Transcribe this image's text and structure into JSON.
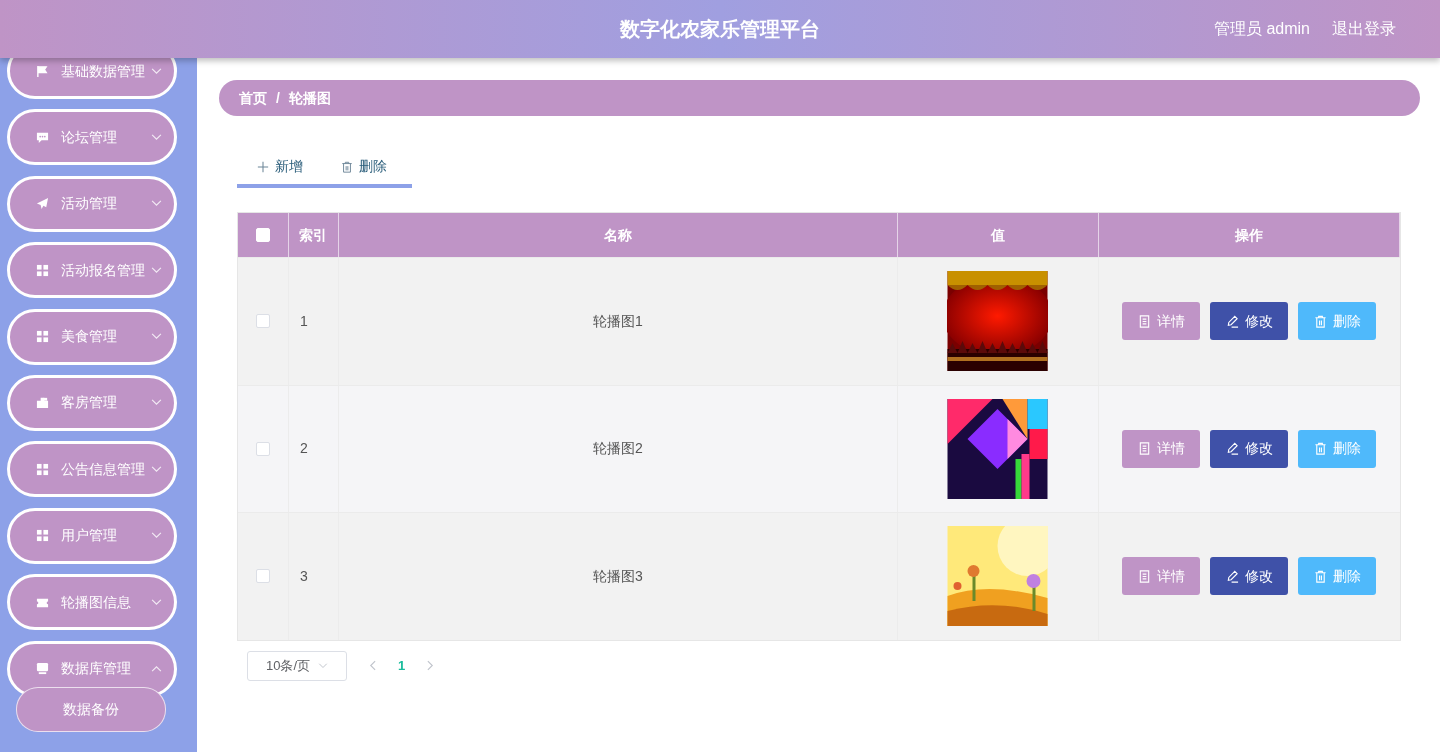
{
  "header": {
    "title": "数字化农家乐管理平台",
    "user": "管理员 admin",
    "logout": "退出登录"
  },
  "sidebar": {
    "items": [
      {
        "label": "基础数据管理",
        "kind": "flag",
        "expanded": false
      },
      {
        "label": "论坛管理",
        "kind": "chat",
        "expanded": false
      },
      {
        "label": "活动管理",
        "kind": "plane",
        "expanded": false
      },
      {
        "label": "活动报名管理",
        "kind": "grid",
        "expanded": false
      },
      {
        "label": "美食管理",
        "kind": "grid",
        "expanded": false
      },
      {
        "label": "客房管理",
        "kind": "case",
        "expanded": false
      },
      {
        "label": "公告信息管理",
        "kind": "grid",
        "expanded": false
      },
      {
        "label": "用户管理",
        "kind": "grid",
        "expanded": false
      },
      {
        "label": "轮播图信息",
        "kind": "ticket",
        "expanded": false
      },
      {
        "label": "数据库管理",
        "kind": "db",
        "expanded": true,
        "children": [
          {
            "label": "数据备份"
          }
        ]
      }
    ]
  },
  "breadcrumb": [
    "首页",
    "轮播图"
  ],
  "breadcrumb_separator": "/",
  "toolbar": [
    {
      "label": "新增",
      "kind": "plus"
    },
    {
      "label": "删除",
      "kind": "trash"
    }
  ],
  "table": {
    "columns": [
      "",
      "索引",
      "名称",
      "值",
      "操作"
    ],
    "select_all_checked": false,
    "rows": [
      {
        "checked": false,
        "index": "1",
        "name": "轮播图1",
        "actions": [
          {
            "label": "详情",
            "kind": "detail"
          },
          {
            "label": "修改",
            "kind": "edit"
          },
          {
            "label": "删除",
            "kind": "delete"
          }
        ]
      },
      {
        "checked": false,
        "index": "2",
        "name": "轮播图2",
        "actions": [
          {
            "label": "详情",
            "kind": "detail"
          },
          {
            "label": "修改",
            "kind": "edit"
          },
          {
            "label": "删除",
            "kind": "delete"
          }
        ]
      },
      {
        "checked": false,
        "index": "3",
        "name": "轮播图3",
        "actions": [
          {
            "label": "详情",
            "kind": "detail"
          },
          {
            "label": "修改",
            "kind": "edit"
          },
          {
            "label": "删除",
            "kind": "delete"
          }
        ]
      }
    ]
  },
  "pagination": {
    "page_size": "10条/页",
    "pages": [
      {
        "label": "1",
        "selected": true
      }
    ]
  }
}
